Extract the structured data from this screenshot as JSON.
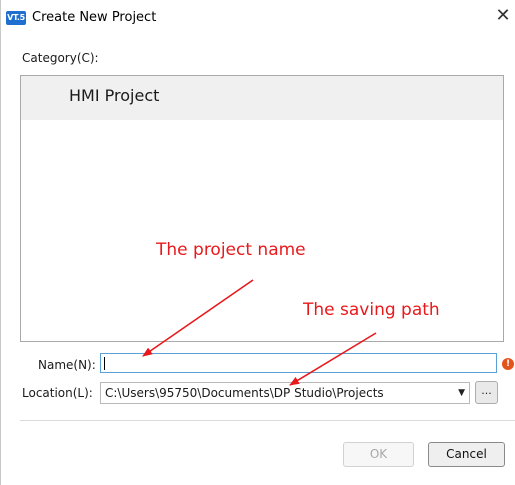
{
  "window": {
    "title": "Create New Project",
    "app_icon_text": "VT.5",
    "close_glyph": "✕"
  },
  "category": {
    "label": "Category(C):",
    "items": [
      {
        "label": "HMI Project",
        "selected": true
      }
    ]
  },
  "annotations": {
    "project_name": "The project name",
    "saving_path": "The saving path",
    "color": "#e8191c"
  },
  "form": {
    "name_label": "Name(N):",
    "name_value": "",
    "location_label": "Location(L):",
    "location_value": "C:\\Users\\95750\\Documents\\DP Studio\\Projects",
    "browse_label": "...",
    "error_icon": "!"
  },
  "buttons": {
    "ok": "OK",
    "cancel": "Cancel"
  }
}
